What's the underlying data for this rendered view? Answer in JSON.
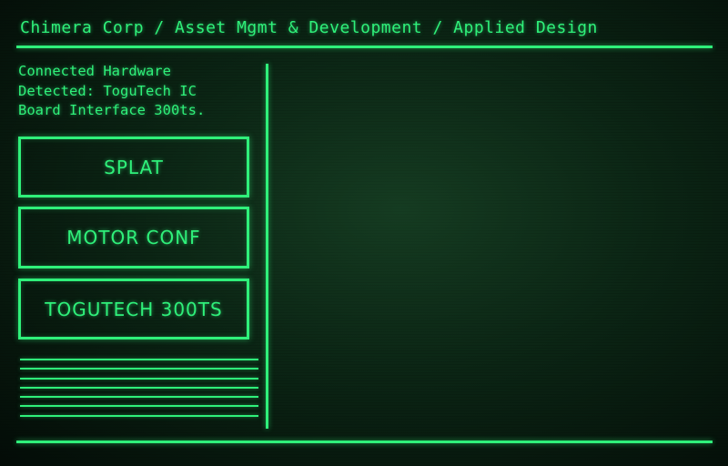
{
  "header": {
    "breadcrumb": "Chimera Corp / Asset Mgmt & Development / Applied Design"
  },
  "status": {
    "line1": "Connected Hardware",
    "line2": "Detected: ToguTech IC",
    "line3": "Board Interface 300ts."
  },
  "menu": {
    "items": [
      {
        "label": "SPLAT"
      },
      {
        "label": "MOTOR CONF"
      },
      {
        "label": "TOGUTECH 300TS"
      }
    ]
  },
  "theme": {
    "accent": "#2ff07a",
    "background": "#0b2414"
  }
}
